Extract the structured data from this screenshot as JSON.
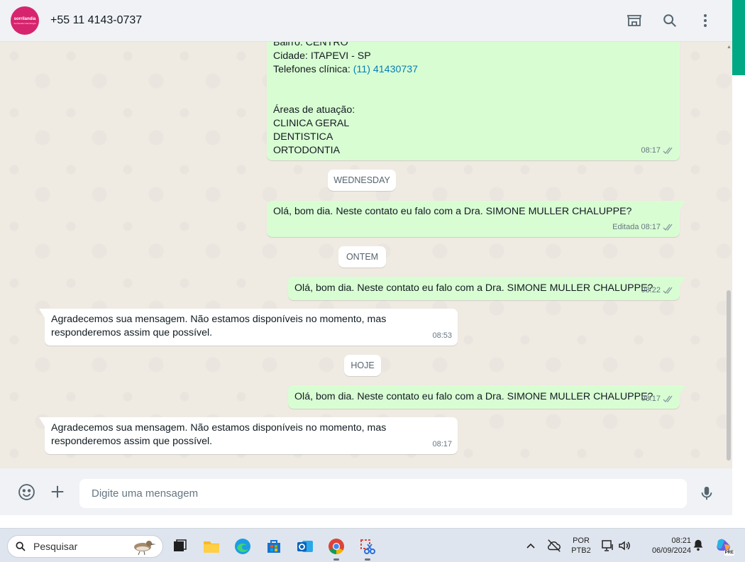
{
  "header": {
    "avatar_text": "sorrilandia",
    "avatar_subtext": "Sorrilandia Odontologia",
    "contact": "+55 11 4143-0737",
    "actions": [
      "store-icon",
      "search-icon",
      "menu-icon"
    ]
  },
  "messages": {
    "first": {
      "lines": [
        "Bairro: CENTRO",
        "Cidade: ITAPEVI - SP"
      ],
      "phone_label": "Telefones clínica: ",
      "phone_link": "(11) 41430737",
      "areas_title": "Áreas de atuação:",
      "areas": [
        "CLINICA GERAL",
        "DENTISTICA",
        "ORTODONTIA"
      ],
      "time": "08:17"
    },
    "chip_wednesday": "WEDNESDAY",
    "second": {
      "text": "Olá, bom dia. Neste contato eu falo com a Dra. SIMONE MULLER CHALUPPE?",
      "edited": "Editada",
      "time": "08:17"
    },
    "chip_yesterday": "ONTEM",
    "third": {
      "text": "Olá, bom dia. Neste contato eu falo com a Dra. SIMONE MULLER CHALUPPE?",
      "time": "08:22"
    },
    "fourth": {
      "line1": "Agradecemos sua mensagem. Não estamos disponíveis no momento, mas",
      "line2": "responderemos assim que possível.",
      "time": "08:53"
    },
    "chip_today": "HOJE",
    "fifth": {
      "text": "Olá, bom dia. Neste contato eu falo com a Dra. SIMONE MULLER CHALUPPE?",
      "time": "08:17"
    },
    "sixth": {
      "line1": "Agradecemos sua mensagem. Não estamos disponíveis no momento, mas",
      "line2": "responderemos assim que possível.",
      "time": "08:17"
    }
  },
  "composer": {
    "placeholder": "Digite uma mensagem",
    "icons": [
      "emoji-icon",
      "plus-icon",
      "microphone-icon"
    ]
  },
  "taskbar": {
    "search_placeholder": "Pesquisar",
    "lang_top": "POR",
    "lang_bottom": "PTB2",
    "time": "08:21",
    "date": "06/09/2024",
    "copilot_badge": "PRE"
  },
  "colors": {
    "accent": "#00a884",
    "outgoing_bubble": "#d9fdd3",
    "incoming_bubble": "#ffffff",
    "chat_background": "#efeae2",
    "link": "#027eb5",
    "avatar": "#d6246e"
  }
}
